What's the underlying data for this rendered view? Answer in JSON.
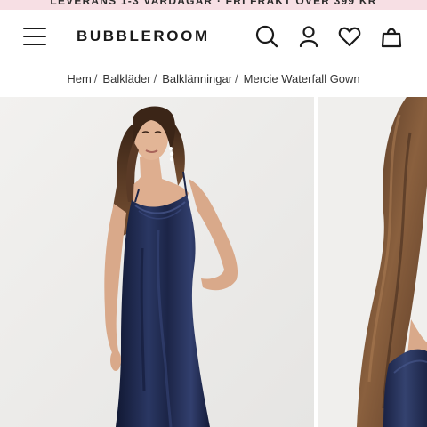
{
  "promo": {
    "text": "LEVERANS 1-3 VARDAGAR · FRI FRAKT ÖVER 399 KR"
  },
  "header": {
    "logo": "BUBBLEROOM",
    "icons": [
      "menu-icon",
      "search-icon",
      "user-icon",
      "heart-icon",
      "bag-icon"
    ]
  },
  "breadcrumb": {
    "items": [
      "Hem",
      "Balkläder",
      "Balklänningar",
      "Mercie Waterfall Gown"
    ],
    "separator": "/"
  },
  "gallery": {
    "images": [
      {
        "name": "Mercie Waterfall Gown – front view"
      },
      {
        "name": "Mercie Waterfall Gown – detail view"
      }
    ]
  },
  "colors": {
    "promo_bg": "#f7dfe4",
    "dress_navy": "#1c2547",
    "photo_bg": "#efeeec",
    "hair_brown": "#5a3a26"
  }
}
